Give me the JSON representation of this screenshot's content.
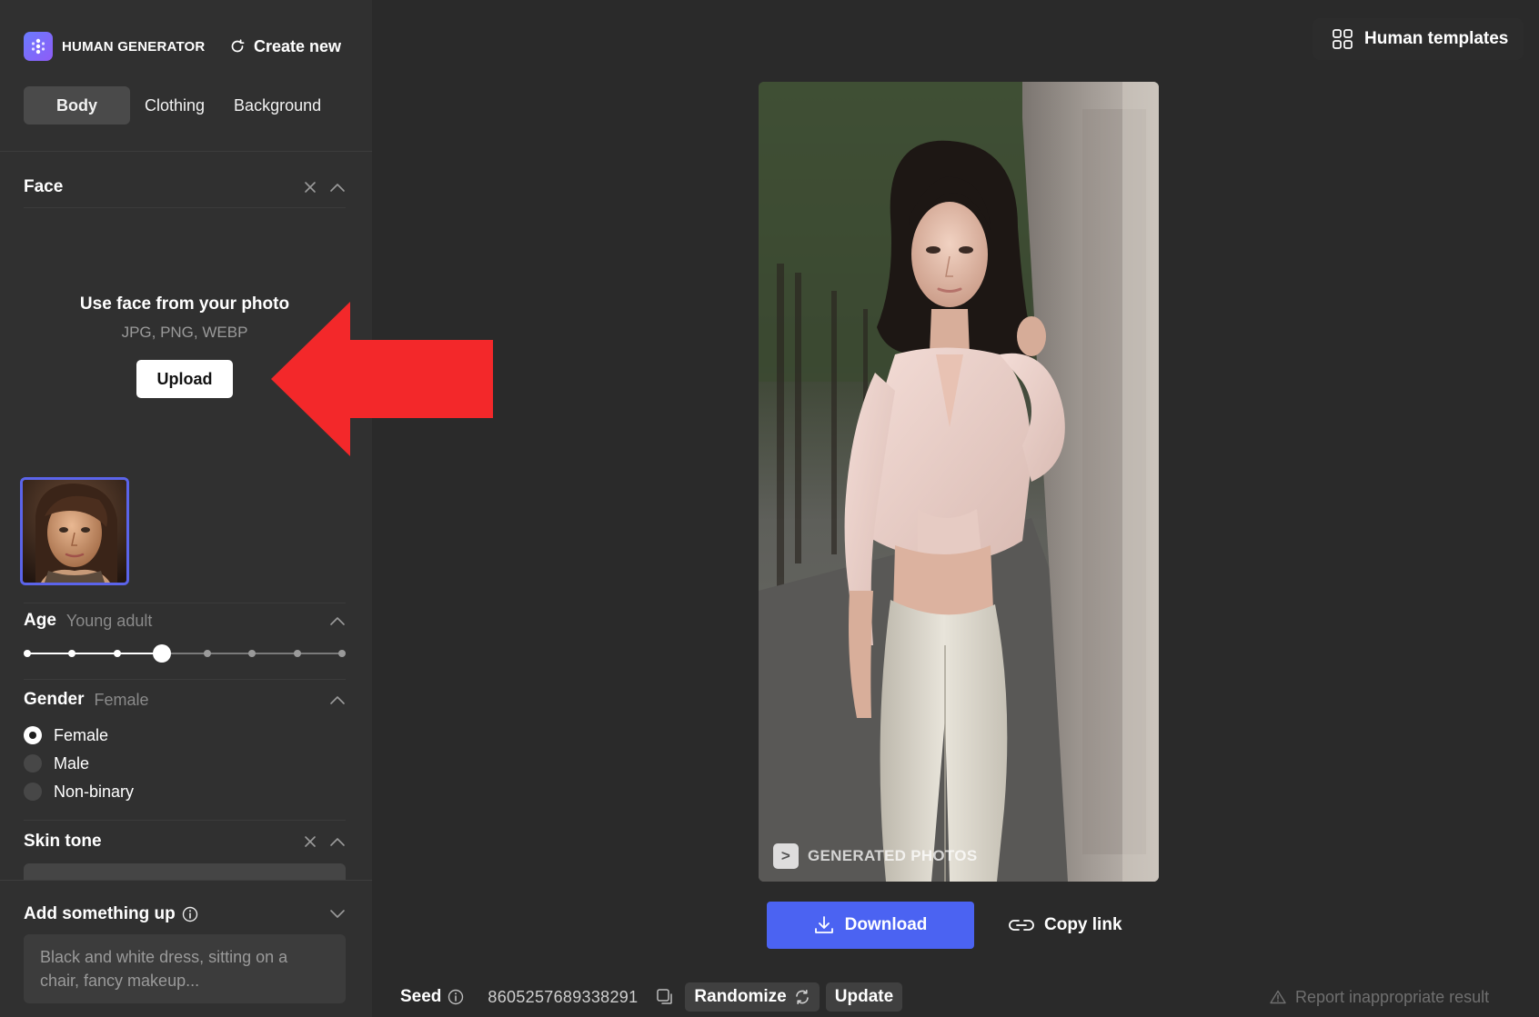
{
  "app": {
    "name": "HUMAN GENERATOR",
    "create_new": "Create new",
    "human_templates": "Human templates"
  },
  "tabs": [
    {
      "label": "Body",
      "active": true
    },
    {
      "label": "Clothing",
      "active": false
    },
    {
      "label": "Background",
      "active": false
    }
  ],
  "face": {
    "title": "Face",
    "upload_title": "Use face from your photo",
    "upload_formats": "JPG, PNG, WEBP",
    "upload_button": "Upload"
  },
  "age": {
    "title": "Age",
    "value": "Young adult",
    "steps": 8,
    "selected_index": 3
  },
  "gender": {
    "title": "Gender",
    "value": "Female",
    "options": [
      {
        "label": "Female",
        "checked": true
      },
      {
        "label": "Male",
        "checked": false
      },
      {
        "label": "Non-binary",
        "checked": false
      }
    ]
  },
  "skin_tone": {
    "title": "Skin tone"
  },
  "add_something": {
    "title": "Add something up",
    "placeholder": "Black and white dress, sitting on a chair, fancy makeup..."
  },
  "image": {
    "watermark": "GENERATED PHOTOS",
    "watermark_badge": ">"
  },
  "actions": {
    "download": "Download",
    "copy_link": "Copy link"
  },
  "seed": {
    "label": "Seed",
    "value": "8605257689338291",
    "randomize": "Randomize",
    "update": "Update"
  },
  "report": "Report inappropriate result",
  "colors": {
    "accent": "#4b63f2",
    "thumb_border": "#5b64ea",
    "sidebar_bg": "#303030",
    "main_bg": "#2a2a2a",
    "annotation_arrow": "#f3282a"
  }
}
